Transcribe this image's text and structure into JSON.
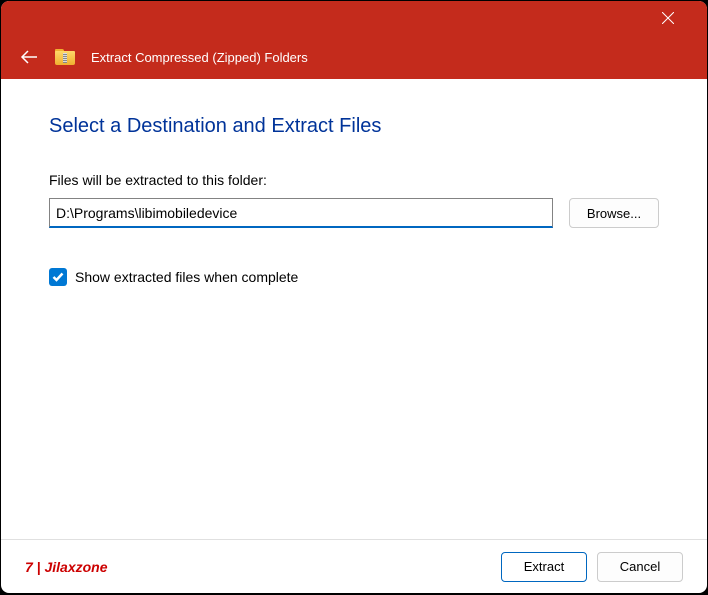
{
  "titlebar": {
    "title": "Extract Compressed (Zipped) Folders"
  },
  "main": {
    "heading": "Select a Destination and Extract Files",
    "field_label": "Files will be extracted to this folder:",
    "path_value": "D:\\Programs\\libimobiledevice",
    "browse_label": "Browse...",
    "checkbox_label": "Show extracted files when complete",
    "checkbox_checked": true
  },
  "footer": {
    "watermark": "7 | Jilaxzone",
    "extract_label": "Extract",
    "cancel_label": "Cancel"
  }
}
